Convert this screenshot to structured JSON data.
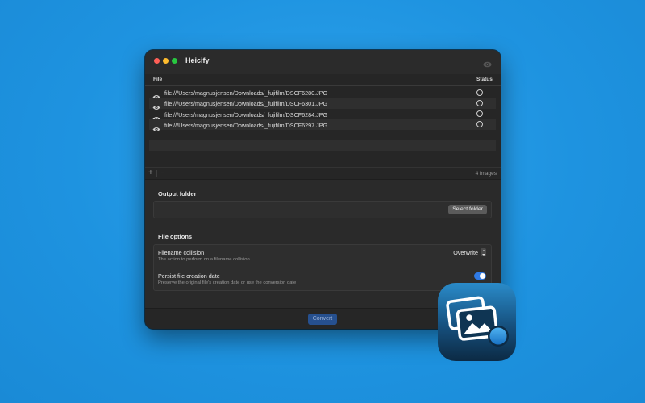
{
  "window": {
    "title": "Heicify",
    "title_icon": "eye-icon"
  },
  "table": {
    "columns": [
      "File",
      "Status"
    ],
    "rows": [
      {
        "path": "file:///Users/magnusjensen/Downloads/_fujifilm/DSCF6280.JPG",
        "status_icon": "circle-empty"
      },
      {
        "path": "file:///Users/magnusjensen/Downloads/_fujifilm/DSCF6301.JPG",
        "status_icon": "circle-empty"
      },
      {
        "path": "file:///Users/magnusjensen/Downloads/_fujifilm/DSCF6284.JPG",
        "status_icon": "circle-empty"
      },
      {
        "path": "file:///Users/magnusjensen/Downloads/_fujifilm/DSCF6297.JPG",
        "status_icon": "circle-empty"
      }
    ],
    "footer": {
      "add_label": "+",
      "remove_label": "−",
      "count": "4 images"
    }
  },
  "output_folder": {
    "section_title": "Output folder",
    "path": "",
    "select_label": "Select folder"
  },
  "file_options": {
    "section_title": "File options",
    "collision": {
      "label": "Filename collision",
      "description": "The action to perform on a filename collision",
      "value": "Overwrite"
    },
    "persist_date": {
      "label": "Persist file creation date",
      "description": "Preserve the original file's creation date or use the conversion date",
      "enabled": true
    }
  },
  "actions": {
    "convert_label": "Convert"
  },
  "colors": {
    "background": "#1e93e0",
    "accent": "#2f7ae5",
    "window": "#262626"
  }
}
